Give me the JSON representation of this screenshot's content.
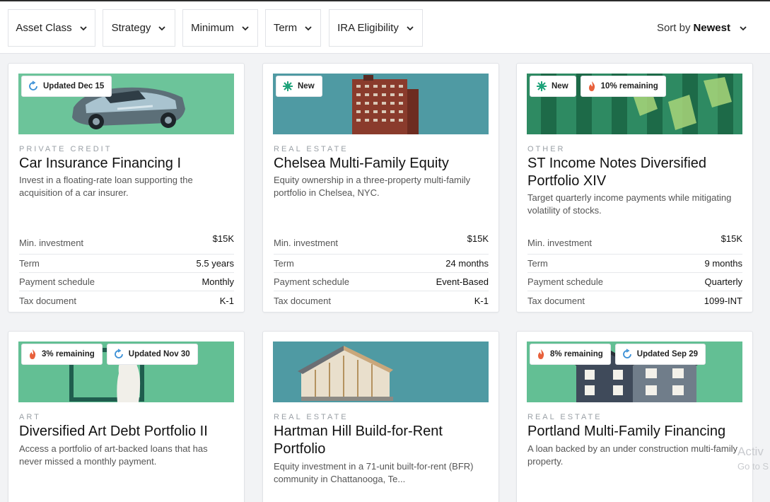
{
  "filters": [
    {
      "label": "Asset Class"
    },
    {
      "label": "Strategy"
    },
    {
      "label": "Minimum"
    },
    {
      "label": "Term"
    },
    {
      "label": "IRA Eligibility"
    }
  ],
  "sort": {
    "prefix": "Sort by",
    "value": "Newest"
  },
  "stat_labels": {
    "min": "Min. investment",
    "term": "Term",
    "schedule": "Payment schedule",
    "tax": "Tax document"
  },
  "cards": [
    {
      "badges": [
        {
          "icon": "refresh-icon",
          "text": "Updated Dec 15"
        }
      ],
      "category": "PRIVATE CREDIT",
      "title": "Car Insurance Financing I",
      "description": "Invest in a floating-rate loan supporting the acquisition of a car insurer.",
      "min": "$15K",
      "term": "5.5 years",
      "schedule": "Monthly",
      "tax": "K-1"
    },
    {
      "badges": [
        {
          "icon": "star-burst-icon",
          "text": "New"
        }
      ],
      "category": "REAL ESTATE",
      "title": "Chelsea Multi-Family Equity",
      "description": "Equity ownership in a three-property multi-family portfolio in Chelsea, NYC.",
      "min": "$15K",
      "term": "24 months",
      "schedule": "Event-Based",
      "tax": "K-1"
    },
    {
      "badges": [
        {
          "icon": "star-burst-icon",
          "text": "New"
        },
        {
          "icon": "flame-icon",
          "text": "10% remaining"
        }
      ],
      "category": "OTHER",
      "title": "ST Income Notes Diversified Portfolio XIV",
      "description": "Target quarterly income payments while mitigating volatility of stocks.",
      "min": "$15K",
      "term": "9 months",
      "schedule": "Quarterly",
      "tax": "1099-INT"
    },
    {
      "badges": [
        {
          "icon": "flame-icon",
          "text": "3% remaining"
        },
        {
          "icon": "refresh-icon",
          "text": "Updated Nov 30"
        }
      ],
      "category": "ART",
      "title": "Diversified Art Debt Portfolio II",
      "description": "Access a portfolio of art-backed loans that has never missed a monthly payment."
    },
    {
      "badges": [],
      "category": "REAL ESTATE",
      "title": "Hartman Hill Build-for-Rent Portfolio",
      "description": "Equity investment in a 71-unit built-for-rent (BFR) community in Chattanooga, Te..."
    },
    {
      "badges": [
        {
          "icon": "flame-icon",
          "text": "8% remaining"
        },
        {
          "icon": "refresh-icon",
          "text": "Updated Sep 29"
        }
      ],
      "category": "REAL ESTATE",
      "title": "Portland Multi-Family Financing",
      "description": "A loan backed by an under construction multi-family property."
    }
  ],
  "watermark": {
    "line1": "Activ",
    "line2": "Go to S"
  },
  "colors": {
    "image_green": "#5fb98c",
    "image_teal": "#4f9aa3",
    "flame": "#e8613c",
    "refresh": "#3a8fd6",
    "new": "#1fa37a"
  }
}
